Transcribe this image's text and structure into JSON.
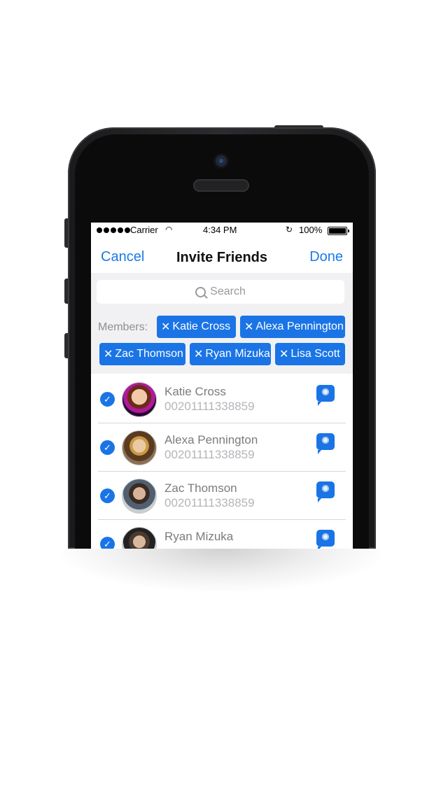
{
  "status_bar": {
    "carrier": "Carrier",
    "wifi_icon": "wifi-icon",
    "time": "4:34 PM",
    "battery": "100%"
  },
  "nav": {
    "cancel": "Cancel",
    "title": "Invite Friends",
    "done": "Done"
  },
  "search": {
    "placeholder": "Search"
  },
  "members": {
    "label": "Members:",
    "chips": [
      "Katie Cross",
      "Alexa Pennington",
      "Zac Thomson",
      "Ryan Mizuka",
      "Lisa Scott"
    ]
  },
  "contacts": [
    {
      "name": "Katie Cross",
      "phone": "00201111338859",
      "selected": true
    },
    {
      "name": "Alexa Pennington",
      "phone": "00201111338859",
      "selected": true
    },
    {
      "name": "Zac Thomson",
      "phone": "00201111338859",
      "selected": true
    },
    {
      "name": "Ryan Mizuka",
      "phone": "",
      "selected": true
    }
  ],
  "colors": {
    "accent": "#1a74e6",
    "header_bg": "#f1f1f3"
  }
}
